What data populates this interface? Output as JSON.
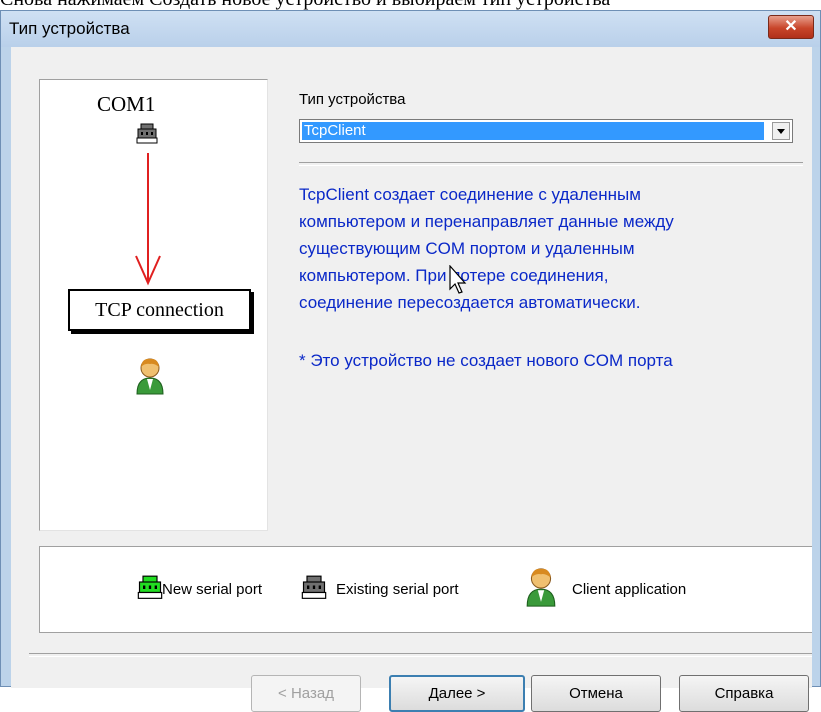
{
  "page_caption": "Снова нажимаем Создать новое устройство и выбираем тип устройства",
  "window": {
    "title": "Тип устройства",
    "close_glyph": "✕"
  },
  "diagram": {
    "port_label": "COM1",
    "connection_label": "TCP connection",
    "arrow_color": "#e02020"
  },
  "device_type": {
    "label": "Тип устройства",
    "selected": "TcpClient"
  },
  "description": {
    "lines": [
      "TcpClient создает соединение с удаленным",
      "компьютером и перенаправляет данные между",
      "существующим COM портом и удаленным",
      "компьютером. При потере соединения,",
      "соединение пересоздается автоматически."
    ],
    "note": "* Это устройство не создает нового COM порта",
    "text_color": "#0a28c8"
  },
  "legend": {
    "new_port": "New serial port",
    "existing_port": "Existing serial port",
    "client_app": "Client application",
    "colors": {
      "new_port": "#22dd22",
      "existing_port": "#707070"
    }
  },
  "buttons": {
    "back": "< Назад",
    "next": "Далее >",
    "cancel": "Отмена",
    "help": "Справка"
  }
}
